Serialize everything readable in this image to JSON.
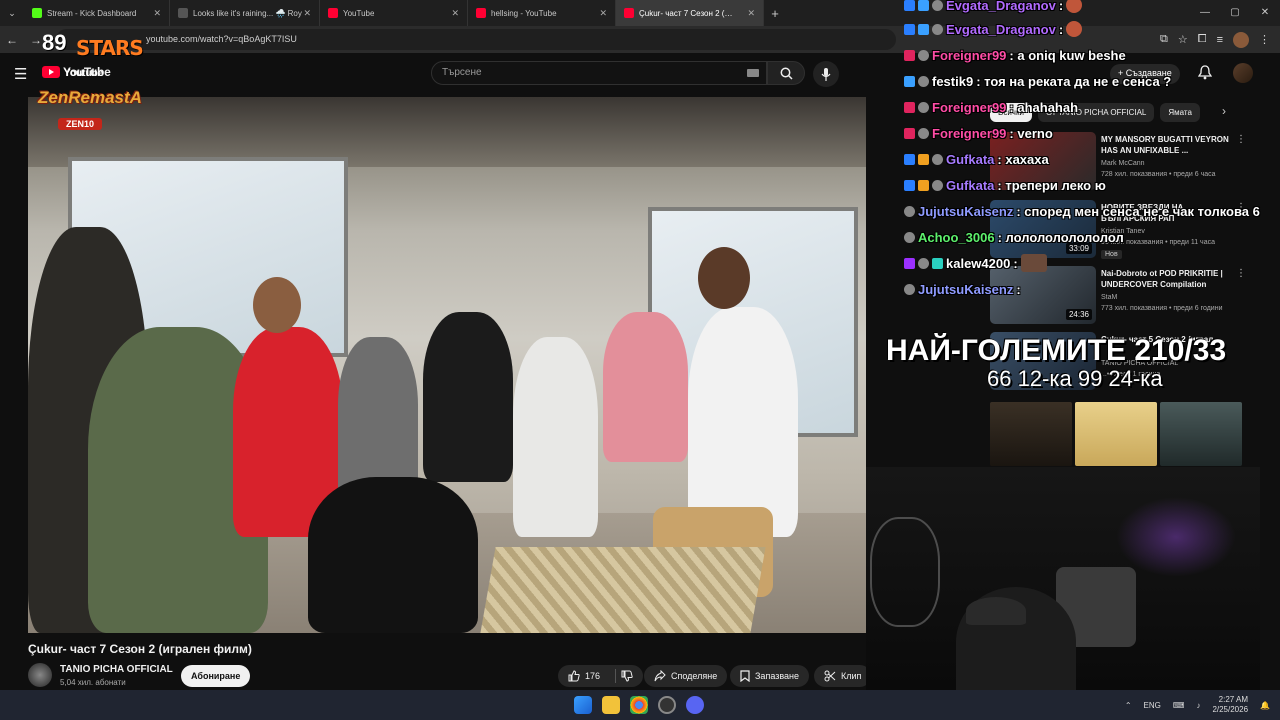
{
  "browser": {
    "tabs": [
      {
        "label": "Stream - Kick Dashboard",
        "color": "#53fc18"
      },
      {
        "label": "Looks like it's raining... 🌧️ Roy",
        "color": "#ffffff"
      },
      {
        "label": "YouTube",
        "color": "#ff0033"
      },
      {
        "label": "hellsing - YouTube",
        "color": "#ff0033"
      },
      {
        "label": "Çukur- част 7 Сезон 2 (игр...",
        "color": "#ff0033"
      }
    ],
    "new_tab": "+",
    "url": "youtube.com/watch?v=qBoAgKT7ISU"
  },
  "youtube": {
    "logo_text": "YouTube",
    "search_placeholder": "Търсене",
    "create_label": "+ Създаване"
  },
  "overlay_brand": {
    "top": "89",
    "stars": "STARS",
    "youtube": "Youtube",
    "zen": "ZenRemastA",
    "zen10": "ZEN10"
  },
  "video": {
    "title": "Çukur- част 7 Сезон 2 (игрален филм)",
    "channel": "TANIO PICHA OFFICIAL",
    "subscribers": "5,04 хил. абонати",
    "subscribe": "Абониране",
    "likes": "176",
    "share": "Споделяне",
    "save": "Запазване",
    "clip": "Клип"
  },
  "chat": [
    {
      "user": "Evgata_Draganov",
      "text": ":",
      "color": "#b26bff"
    },
    {
      "user": "Evgata_Draganov",
      "text": ":",
      "color": "#b26bff"
    },
    {
      "user": "Foreigner99",
      "text": ": a oniq kuw beshe",
      "color": "#ff4da6"
    },
    {
      "user": "festik9",
      "text": ": тоя на реката да не е сенса ?",
      "color": "#ffffff"
    },
    {
      "user": "Foreigner99",
      "text": ": ahahahah",
      "color": "#ff4da6"
    },
    {
      "user": "Foreigner99",
      "text": ": verno",
      "color": "#ff4da6"
    },
    {
      "user": "Gufkata",
      "text": ": хахаха",
      "color": "#a67bff"
    },
    {
      "user": "Gufkata",
      "text": ": трепери леко ю",
      "color": "#a67bff"
    },
    {
      "user": "JujutsuKaisenz",
      "text": ": според мен сенса не е чак толкова 6",
      "color": "#8f9bff"
    },
    {
      "user": "Achoo_3006",
      "text": ": лололололололол",
      "color": "#5df06c"
    },
    {
      "user": "kalew4200",
      "text": ":",
      "color": "#ffffff"
    },
    {
      "user": "JujutsuKaisenz",
      "text": ":",
      "color": "#8f9bff"
    }
  ],
  "sidebar": {
    "chips": [
      "Всички",
      "От TANIO PICHA OFFICIAL",
      "Ямата"
    ],
    "recs": [
      {
        "title": "MY MANSORY BUGATTI VEYRON HAS AN UNFIXABLE ...",
        "channel": "Mark McCann",
        "meta": "728 хил. показвания • преди 6 часа",
        "duration": "",
        "new": ""
      },
      {
        "title": "НОВИТЕ ЗВЕЗДИ НА БЪЛГАРСКИЯ РАП",
        "channel": "Kristian Tanev",
        "meta": "96 хил. показвания • преди 11 часа",
        "duration": "33:09",
        "new": "Нов"
      },
      {
        "title": "Nai-Dobroto ot POD PRIKRITIE | UNDERCOVER Compilation",
        "channel": "StaM",
        "meta": "773 хил. показвания • преди 6 години",
        "duration": "24:36",
        "new": ""
      },
      {
        "title": "Çukur- част 5 Сезон 2 (играл...",
        "channel": "TANIO PICHA OFFICIAL",
        "meta": "...• преди 1 година",
        "duration": "",
        "new": ""
      }
    ]
  },
  "overlay_text": {
    "line1": "НАЙ-ГОЛЕМИТЕ 210/33",
    "line2": "66 12-ка 99 24-ка"
  },
  "taskbar": {
    "lang": "ENG",
    "time": "2:27 AM",
    "date": "2/25/2026"
  }
}
